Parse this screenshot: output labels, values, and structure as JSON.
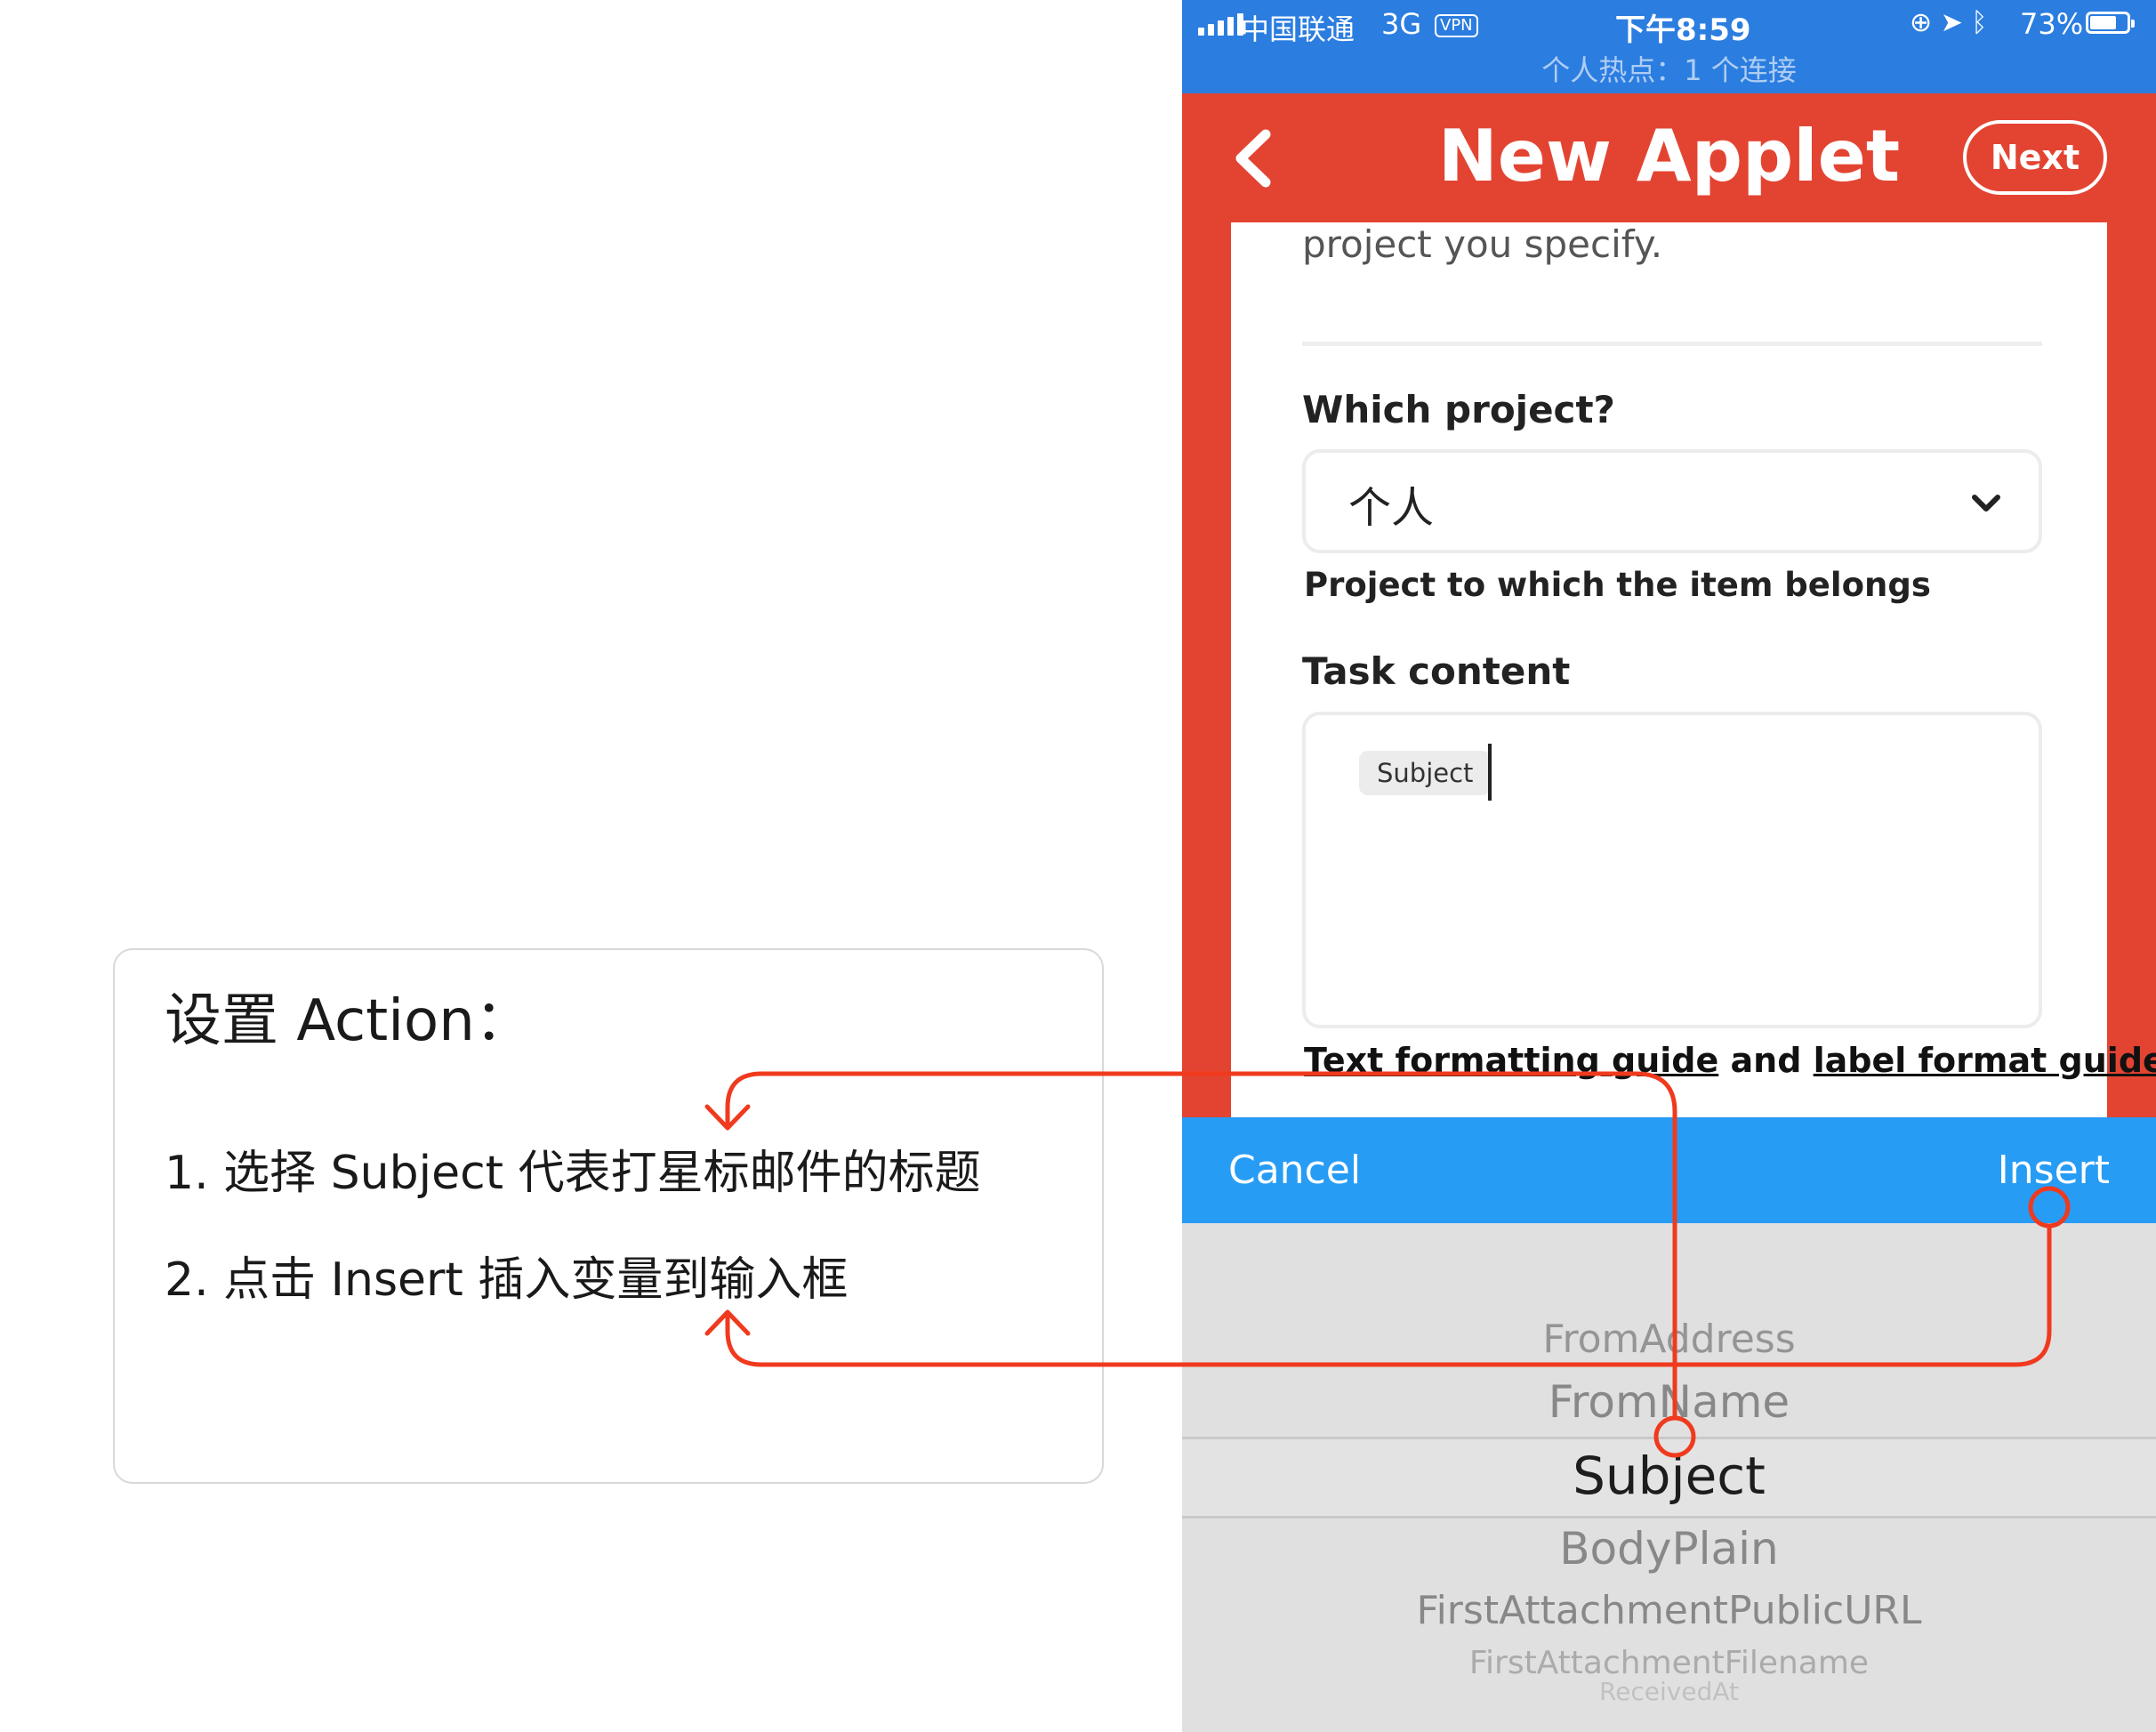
{
  "annotation": {
    "title": "设置 Action：",
    "step1": "1. 选择 Subject 代表打星标邮件的标题",
    "step2": "2. 点击 Insert 插入变量到输入框"
  },
  "status_bar": {
    "carrier": "中国联通",
    "network": "3G",
    "vpn": "VPN",
    "time": "下午8:59",
    "battery_percent": "73%",
    "battery_level": 0.73,
    "hotspot": "个人热点：1 个连接"
  },
  "nav": {
    "title": "New Applet",
    "next_label": "Next"
  },
  "form": {
    "description_partial": "project you specify.",
    "project_label": "Which project?",
    "project_value": "个人",
    "project_hint": "Project to which the item belongs",
    "task_label": "Task content",
    "task_ingredient": "Subject",
    "guide_link_1": "Text formatting guide",
    "guide_and": " and ",
    "guide_link_2": "label format guide"
  },
  "picker_toolbar": {
    "cancel_label": "Cancel",
    "insert_label": "Insert"
  },
  "picker": {
    "options": [
      "FromAddress",
      "FromName",
      "Subject",
      "BodyPlain",
      "FirstAttachmentPublicURL",
      "FirstAttachmentFilename",
      "ReceivedAt"
    ],
    "selected": "Subject"
  },
  "colors": {
    "ifttt_red": "#e34432",
    "status_blue": "#2b7de0",
    "toolbar_blue": "#279cf5",
    "annotation_red": "#f03a1e"
  },
  "icons": {
    "back": "chevron-left-icon",
    "dropdown": "chevron-down-icon",
    "arrow_down": "arrow-down-icon",
    "arrow_up": "arrow-up-icon"
  }
}
